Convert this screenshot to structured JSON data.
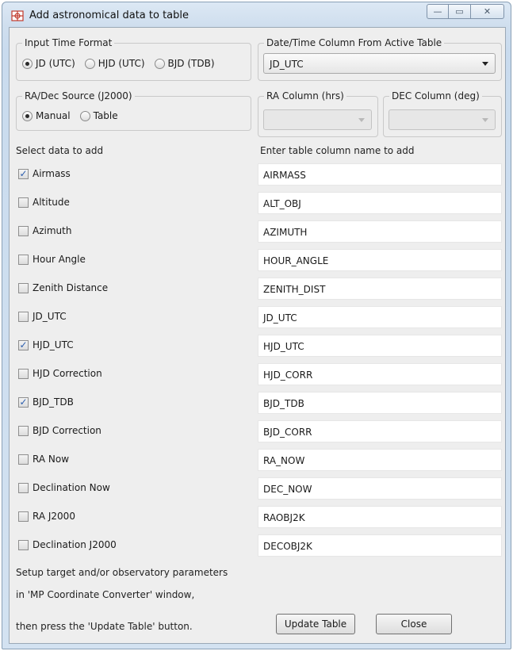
{
  "window": {
    "title": "Add astronomical data to table",
    "controls": {
      "minimize": "—",
      "maximize": "▭",
      "close": "✕"
    }
  },
  "input_time_format": {
    "title": "Input Time Format",
    "options": [
      "JD (UTC)",
      "HJD (UTC)",
      "BJD (TDB)"
    ],
    "selected": "JD (UTC)"
  },
  "date_time_column": {
    "title": "Date/Time Column From Active Table",
    "value": "JD_UTC"
  },
  "radec_source": {
    "title": "RA/Dec Source (J2000)",
    "options": [
      "Manual",
      "Table"
    ],
    "selected": "Manual"
  },
  "ra_column": {
    "title": "RA Column (hrs)",
    "value": ""
  },
  "dec_column": {
    "title": "DEC Column (deg)",
    "value": ""
  },
  "headers": {
    "select": "Select data to add",
    "enter": "Enter table column name to add"
  },
  "rows": [
    {
      "label": "Airmass",
      "checked": true,
      "column": "AIRMASS"
    },
    {
      "label": "Altitude",
      "checked": false,
      "column": "ALT_OBJ"
    },
    {
      "label": "Azimuth",
      "checked": false,
      "column": "AZIMUTH"
    },
    {
      "label": "Hour Angle",
      "checked": false,
      "column": "HOUR_ANGLE"
    },
    {
      "label": "Zenith Distance",
      "checked": false,
      "column": "ZENITH_DIST"
    },
    {
      "label": "JD_UTC",
      "checked": false,
      "column": "JD_UTC"
    },
    {
      "label": "HJD_UTC",
      "checked": true,
      "column": "HJD_UTC"
    },
    {
      "label": "HJD Correction",
      "checked": false,
      "column": "HJD_CORR"
    },
    {
      "label": "BJD_TDB",
      "checked": true,
      "column": "BJD_TDB"
    },
    {
      "label": "BJD Correction",
      "checked": false,
      "column": "BJD_CORR"
    },
    {
      "label": "RA Now",
      "checked": false,
      "column": "RA_NOW"
    },
    {
      "label": "Declination Now",
      "checked": false,
      "column": "DEC_NOW"
    },
    {
      "label": "RA J2000",
      "checked": false,
      "column": "RAOBJ2K"
    },
    {
      "label": "Declination J2000",
      "checked": false,
      "column": "DECOBJ2K"
    }
  ],
  "footer": {
    "line1": "Setup target and/or observatory parameters",
    "line2": "in 'MP Coordinate Converter' window,",
    "line3": "then press the 'Update Table' button.",
    "update_button": "Update Table",
    "close_button": "Close"
  }
}
